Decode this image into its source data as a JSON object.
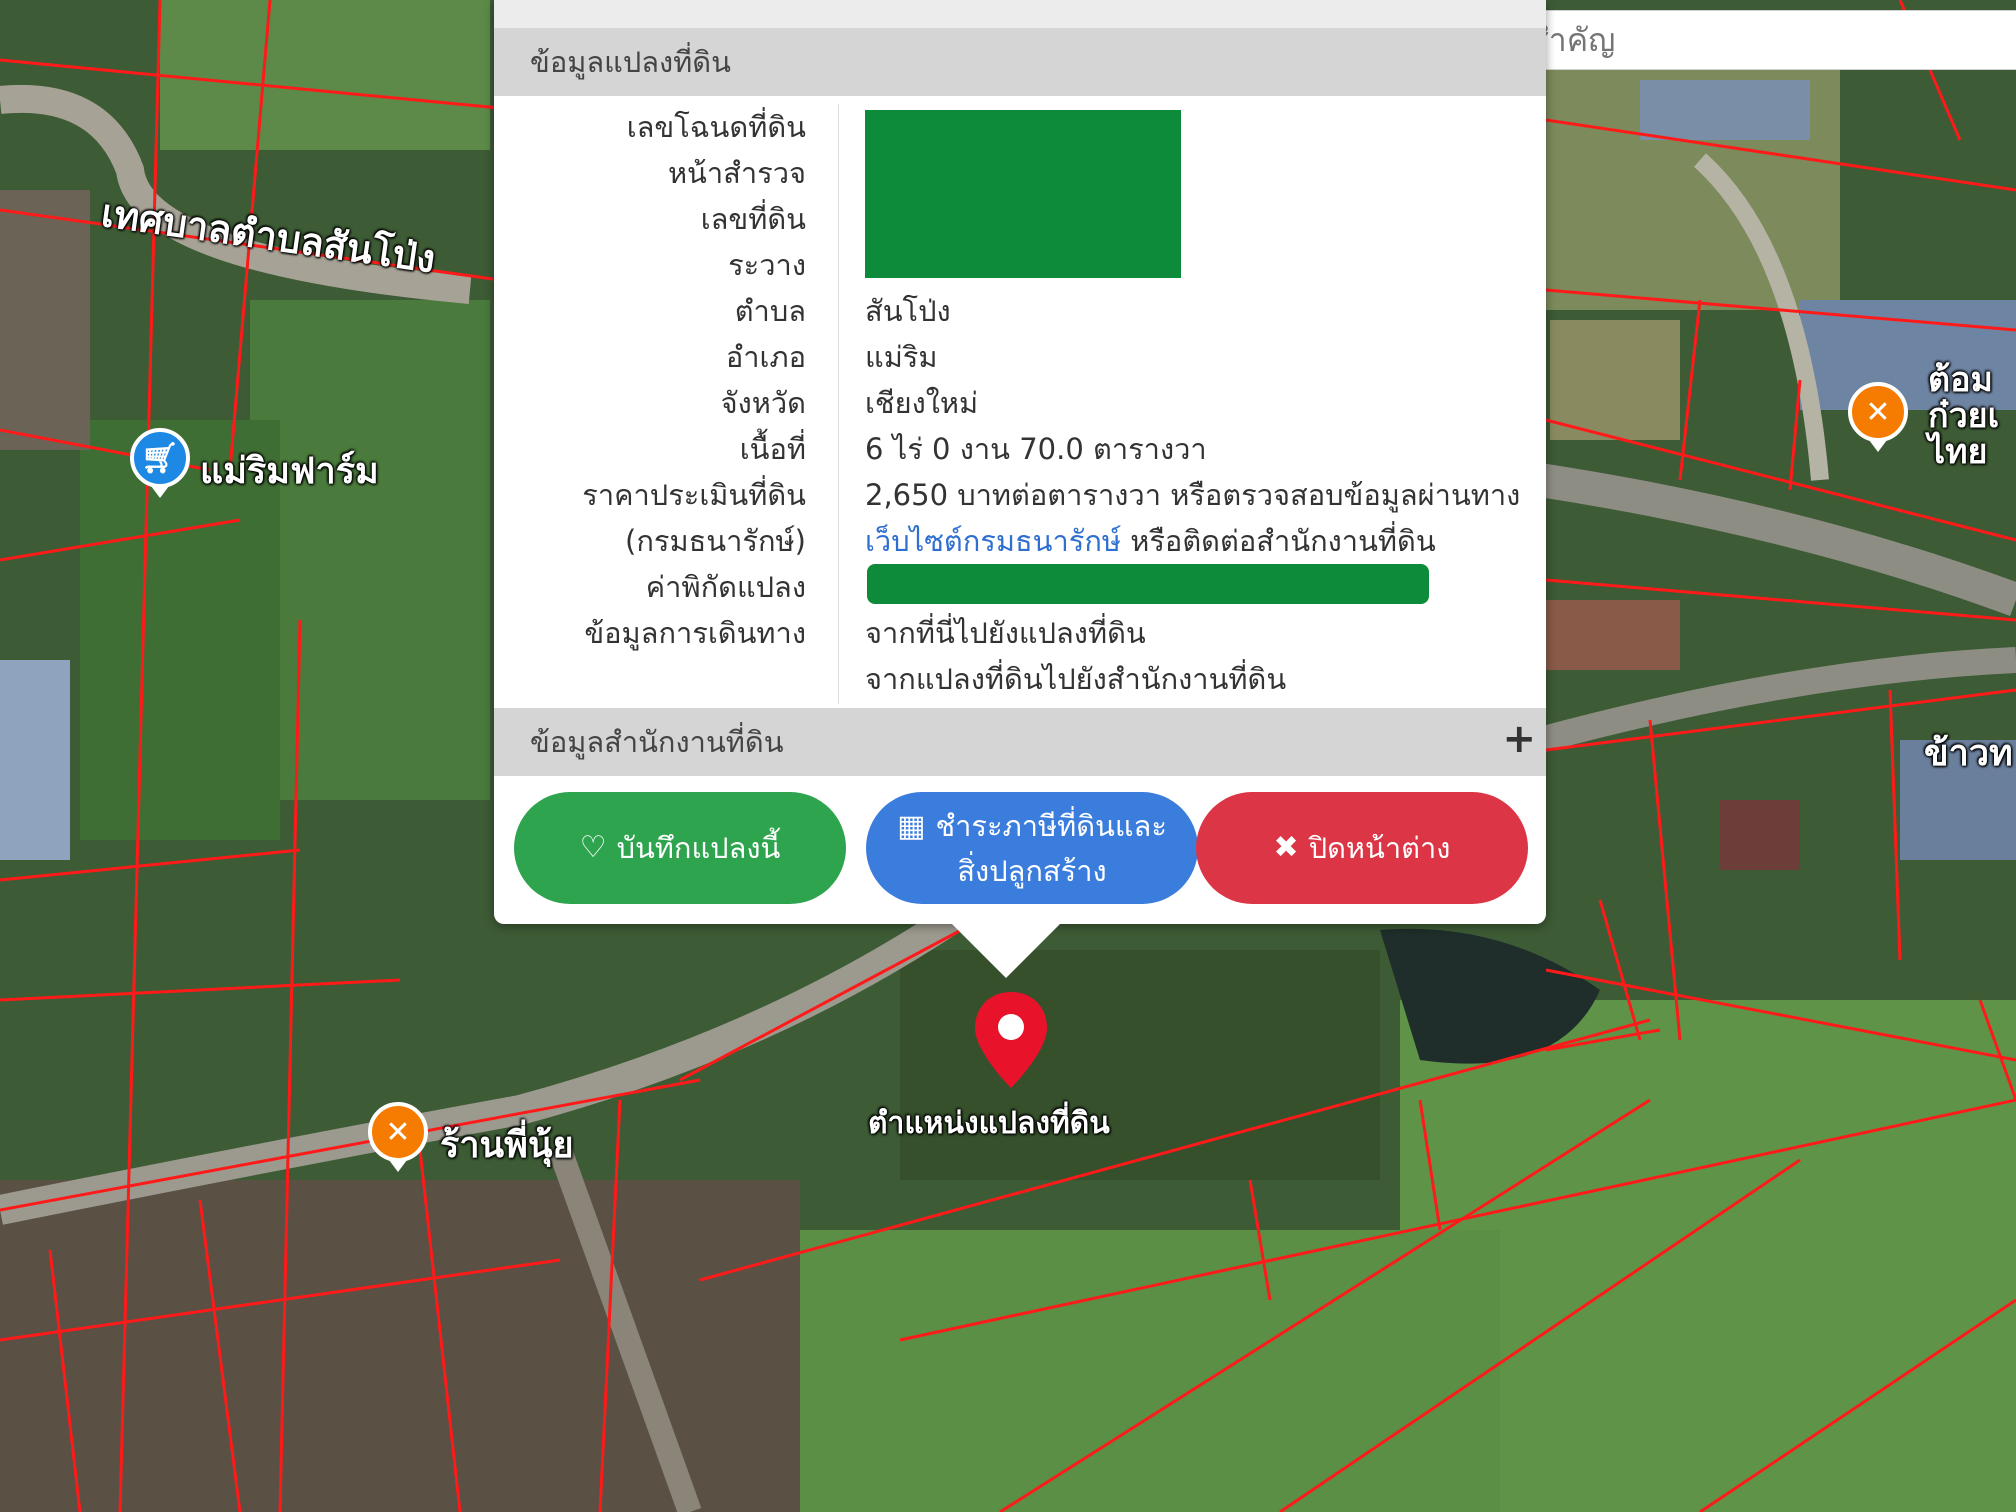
{
  "search": {
    "placeholder": "ค้นหาสถานที่สำคัญ"
  },
  "map": {
    "road_label": "เทศบาลตำบลสันโป่ง",
    "pois": [
      {
        "name": "แม่ริมฟาร์ม",
        "icon": "cart-icon",
        "color": "#1e88e5"
      },
      {
        "name": "ร้านพี่นุ้ย",
        "icon": "restaurant-icon",
        "color": "#f57c00"
      },
      {
        "name": "ต้อม ก๋วยเ ไทย",
        "icon": "restaurant-icon",
        "color": "#f57c00"
      },
      {
        "name": "ข้าวท",
        "icon": "",
        "color": ""
      }
    ],
    "pin_label": "ตำแหน่งแปลงที่ดิน",
    "pin_color": "#e8132b"
  },
  "popup": {
    "section1_title": "ข้อมูลแปลงที่ดิน",
    "section2_title": "ข้อมูลสำนักงานที่ดิน",
    "expand_symbol": "+",
    "rows": {
      "deed_no_label": "เลขโฉนดที่ดิน",
      "survey_page_label": "หน้าสำรวจ",
      "land_no_label": "เลขที่ดิน",
      "sheet_label": "ระวาง",
      "subdistrict_label": "ตำบล",
      "subdistrict_value": "สันโป่ง",
      "district_label": "อำเภอ",
      "district_value": "แม่ริม",
      "province_label": "จังหวัด",
      "province_value": "เชียงใหม่",
      "area_label": "เนื้อที่",
      "area_value": "6 ไร่ 0 งาน 70.0 ตารางวา",
      "price_label_1": "ราคาประเมินที่ดิน",
      "price_label_2": "(กรมธนารักษ์)",
      "price_value_1": "2,650 บาทต่อตารางวา หรือตรวจสอบข้อมูลผ่านทาง",
      "price_link": "เว็บไซต์กรมธนารักษ์",
      "price_value_2": " หรือติดต่อสำนักงานที่ดิน",
      "coords_label": "ค่าพิกัดแปลง",
      "travel_label": "ข้อมูลการเดินทาง",
      "travel_link_1": "จากที่นี่ไปยังแปลงที่ดิน",
      "travel_link_2": "จากแปลงที่ดินไปยังสำนักงานที่ดิน"
    },
    "redaction_color": "#0e8a3b",
    "buttons": {
      "save_label": "บันทึกแปลงนี้",
      "save_color": "#2ea44f",
      "tax_label_1": "ชำระภาษีที่ดินและ",
      "tax_label_2": "สิ่งปลูกสร้าง",
      "tax_color": "#3b7ddd",
      "close_label": "ปิดหน้าต่าง",
      "close_color": "#dc3545"
    }
  }
}
